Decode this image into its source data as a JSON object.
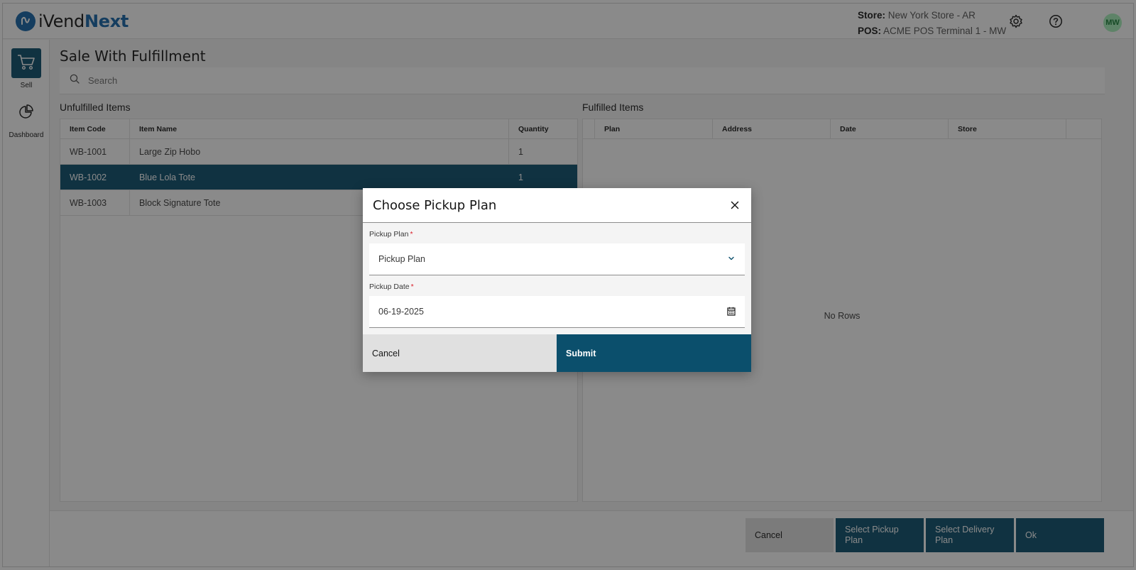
{
  "header": {
    "logo_i": "i",
    "logo_vend": "Vend",
    "logo_next": "Next",
    "store_label": "Store:",
    "store_value": "New York Store - AR",
    "pos_label": "POS:",
    "pos_value": "ACME POS Terminal 1 - MW",
    "avatar_initials": "MW",
    "icons": [
      "settings-icon",
      "help-icon"
    ]
  },
  "sidenav": {
    "items": [
      {
        "label": "Sell",
        "icon": "cart-icon",
        "active": true
      },
      {
        "label": "Dashboard",
        "icon": "pie-chart-icon",
        "active": false
      }
    ]
  },
  "page": {
    "title": "Sale With Fulfillment",
    "search_placeholder": "Search"
  },
  "unfulfilled": {
    "title": "Unfulfilled Items",
    "columns": [
      "Item Code",
      "Item Name",
      "Quantity"
    ],
    "rows": [
      {
        "code": "WB-1001",
        "name": "Large Zip Hobo",
        "qty": "1",
        "selected": false
      },
      {
        "code": "WB-1002",
        "name": "Blue Lola Tote",
        "qty": "1",
        "selected": true
      },
      {
        "code": "WB-1003",
        "name": "Block Signature Tote",
        "qty": "",
        "selected": false
      }
    ]
  },
  "fulfilled": {
    "title": "Fulfilled Items",
    "columns": [
      "Plan",
      "Address",
      "Date",
      "Store"
    ],
    "empty_text": "No Rows"
  },
  "footer": {
    "cancel": "Cancel",
    "select_pickup": "Select Pickup Plan",
    "select_delivery": "Select Delivery Plan",
    "ok": "Ok"
  },
  "modal": {
    "title": "Choose Pickup Plan",
    "pickup_plan_label": "Pickup Plan",
    "pickup_plan_value": "Pickup Plan",
    "pickup_date_label": "Pickup Date",
    "pickup_date_value": "06-19-2025",
    "required_marker": "*",
    "cancel": "Cancel",
    "submit": "Submit"
  },
  "colors": {
    "primary": "#0b4f6c",
    "brand": "#1565a8",
    "required": "#da1e28"
  }
}
